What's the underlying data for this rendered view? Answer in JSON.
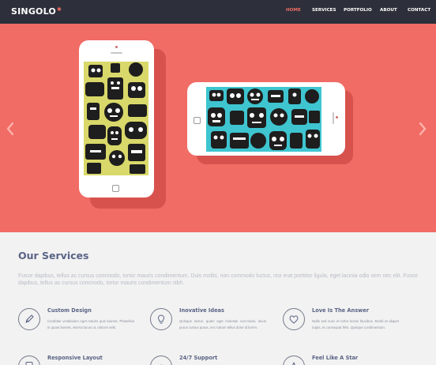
{
  "brand": {
    "name": "SINGOLO",
    "accent": "#f06c64"
  },
  "nav": {
    "items": [
      {
        "label": "HOME",
        "active": true
      },
      {
        "label": "SERVICES",
        "active": false
      },
      {
        "label": "PORTFOLIO",
        "active": false
      },
      {
        "label": "ABOUT",
        "active": false
      },
      {
        "label": "CONTACT",
        "active": false
      }
    ]
  },
  "slider": {
    "background": "#f06c65",
    "prev_icon": "chevron-left-icon",
    "next_icon": "chevron-right-icon"
  },
  "services": {
    "title": "Our Services",
    "intro": "Fusce dapibus, tellus ac cursus commodo, tortor mauris condimentum. Duis mollis, non commodo luctus, nisi erat porttitor ligula, eget lacinia odio sem nec elit. Fusce dapibus, tellus as cursus commodo, tortor mauris condimentum nibh.",
    "items": [
      {
        "title": "Custom Design",
        "icon": "pencil-icon",
        "text": "Curabitur vestibulum eget mauris quis laoreet. Phasellus in quam laoreet, viverra lacus ut, ultrices velit."
      },
      {
        "title": "Inovative Ideas",
        "icon": "lightbulb-icon",
        "text": "Quisque luctus, quam eget molestie con-modo, lacus purus cursus purus, nec rutrum tellus dolor id lorem."
      },
      {
        "title": "Love Is The Answer",
        "icon": "heart-icon",
        "text": "Nulla sed nunc et tortor luctus faucibus. Morbi at aliquet turpis, et consequat felis. Quisque condimentum."
      },
      {
        "title": "Responsive Layout",
        "icon": "tablet-icon",
        "text": ""
      },
      {
        "title": "24/7 Support",
        "icon": "headset-icon",
        "text": ""
      },
      {
        "title": "Feel Like A Star",
        "icon": "star-icon",
        "text": ""
      }
    ]
  }
}
